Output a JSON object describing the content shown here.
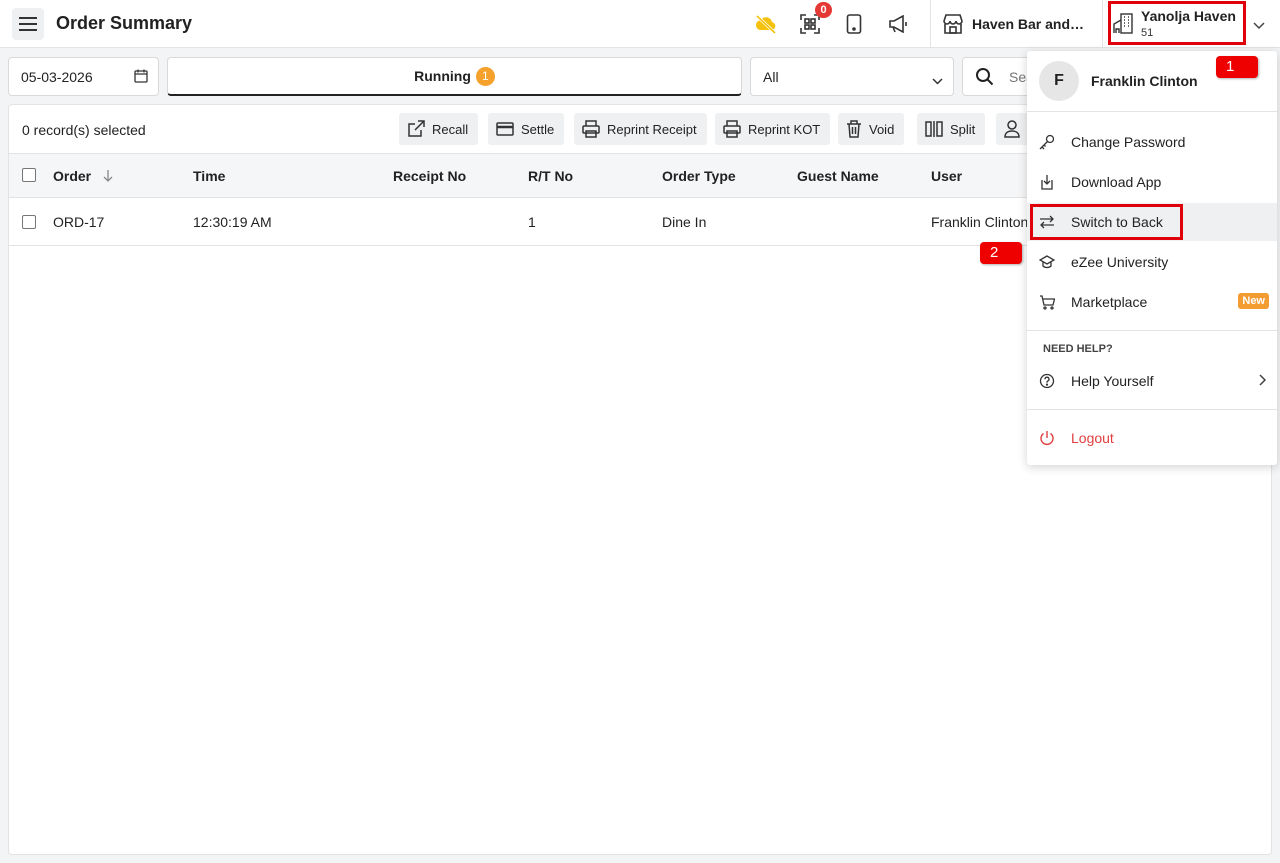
{
  "header": {
    "title": "Order Summary",
    "notification_count": "0",
    "outlet_name": "Haven Bar and Restaurant",
    "property_name": "Yanolja Haven",
    "property_sub": "51"
  },
  "filters": {
    "date": "05-03-2026",
    "status_tab": "Running",
    "status_count": "1",
    "order_filter": "All",
    "search_placeholder": "Search"
  },
  "toolbar": {
    "selected_text": "0 record(s) selected",
    "buttons": [
      "Recall",
      "Settle",
      "Reprint Receipt",
      "Reprint KOT",
      "Void",
      "Split"
    ]
  },
  "table": {
    "columns": [
      "Order",
      "Time",
      "Receipt No",
      "R/T No",
      "Order Type",
      "Guest Name",
      "User"
    ],
    "rows": [
      {
        "order": "ORD-17",
        "time": "12:30:19 AM",
        "receipt_no": "",
        "rt_no": "1",
        "order_type": "Dine In",
        "guest_name": "",
        "user": "Franklin Clinton"
      }
    ]
  },
  "user_menu": {
    "avatar_letter": "F",
    "user_name": "Franklin Clinton",
    "items": [
      "Change Password",
      "Download App",
      "Switch to Back",
      "eZee University",
      "Marketplace"
    ],
    "new_badge": "New",
    "help_heading": "NEED HELP?",
    "help_item": "Help Yourself",
    "logout": "Logout"
  },
  "annotations": {
    "mark1": "1",
    "mark2": "2"
  },
  "colors": {
    "accent_orange": "#f5a12b",
    "badge_red": "#e53935",
    "highlight_red": "#e0000a",
    "logout_red": "#e04040"
  }
}
